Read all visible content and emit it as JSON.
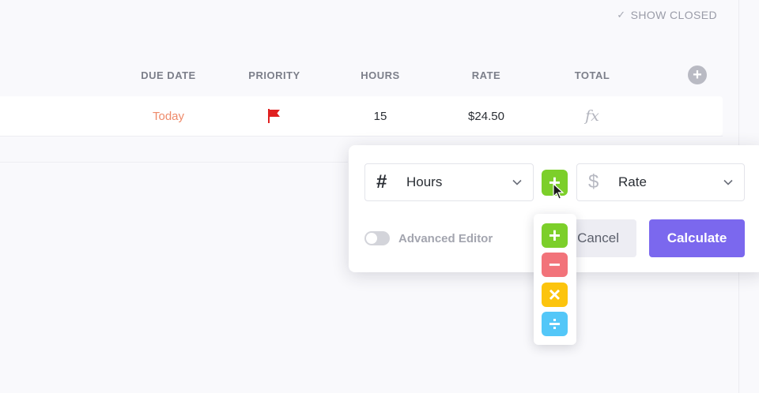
{
  "toolbar": {
    "show_closed_label": "SHOW CLOSED",
    "show_closed_icon": "check-icon"
  },
  "columns": {
    "due_date": "DUE DATE",
    "priority": "PRIORITY",
    "hours": "HOURS",
    "rate": "RATE",
    "total": "TOTAL",
    "add_icon": "plus-circle-icon"
  },
  "task_row": {
    "due_date": "Today",
    "priority_icon": "flag-icon",
    "priority_color": "#e02020",
    "hours": "15",
    "rate": "$24.50",
    "total_icon": "fx",
    "total_icon_name": "formula-icon"
  },
  "formula_popover": {
    "left_field": {
      "icon": "#",
      "label": "Hours"
    },
    "operator": {
      "symbol": "+",
      "color": "#7ccf2a"
    },
    "right_field": {
      "icon": "$",
      "label": "Rate"
    },
    "advanced_editor_label": "Advanced Editor",
    "advanced_editor_enabled": false,
    "cancel_label": "Cancel",
    "calculate_label": "Calculate",
    "calculate_color": "#7b68ee"
  },
  "operator_menu": [
    {
      "name": "add",
      "symbol": "+",
      "color": "#7ccf2a"
    },
    {
      "name": "subtract",
      "symbol": "−",
      "color": "#f2737a"
    },
    {
      "name": "multiply",
      "symbol": "×",
      "color": "#fcc40d"
    },
    {
      "name": "divide",
      "symbol": "÷",
      "color": "#53c7f8"
    }
  ]
}
